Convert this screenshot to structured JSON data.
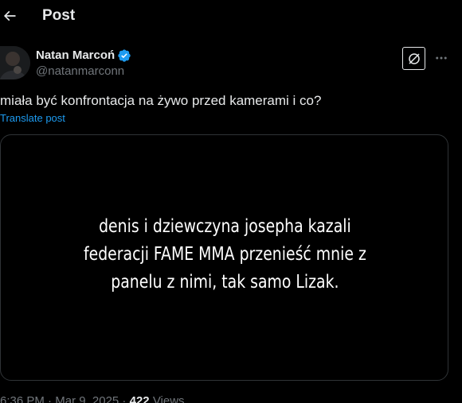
{
  "header": {
    "title": "Post",
    "back_icon": "arrow-left-icon"
  },
  "author": {
    "name": "Natan Marcoń",
    "handle": "@natanmarconn",
    "verified_icon": "verified-badge-icon",
    "verified_color": "#1d9bf0"
  },
  "actions": {
    "grok_icon": "grok-icon",
    "more_icon": "more-horizontal-icon"
  },
  "post": {
    "text": "miała być konfrontacja na żywo przed kamerami i co?",
    "translate_label": "Translate post"
  },
  "media": {
    "lines": [
      "denis i dziewczyna josepha kazali",
      "federacji FAME MMA przenieść mnie z",
      "panelu z nimi, tak samo Lizak."
    ]
  },
  "meta": {
    "time": "6:36 PM",
    "separator": " · ",
    "date": "Mar 9, 2025",
    "views_count": "422",
    "views_label": "Views"
  },
  "colors": {
    "background": "#000000",
    "text": "#e7e9ea",
    "muted": "#71767b",
    "link": "#1d9bf0",
    "border": "#2f3336"
  }
}
